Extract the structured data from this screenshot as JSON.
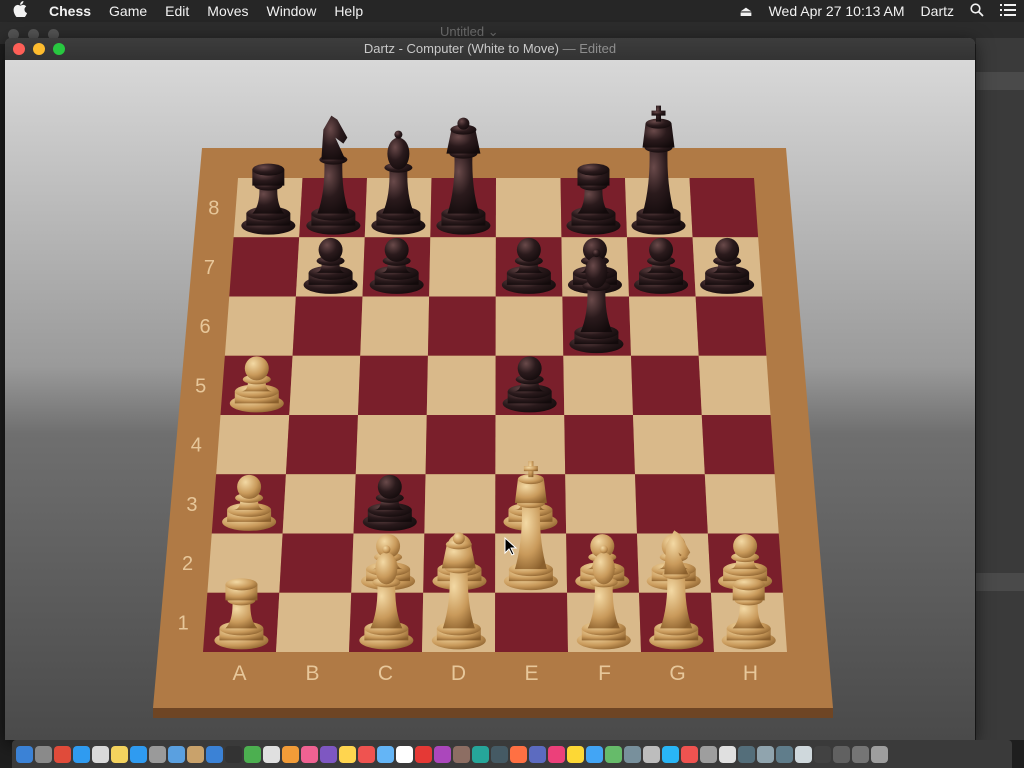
{
  "menubar": {
    "apple": "",
    "items": [
      "Chess",
      "Game",
      "Edit",
      "Moves",
      "Window",
      "Help"
    ],
    "datetime": "Wed Apr 27  10:13 AM",
    "user": "Dartz"
  },
  "background_window": {
    "title": "Untitled ⌄"
  },
  "window": {
    "title": "Dartz - Computer   (White to Move)",
    "edited": " — Edited"
  },
  "board": {
    "files": [
      "A",
      "B",
      "C",
      "D",
      "E",
      "F",
      "G",
      "H"
    ],
    "ranks": [
      "8",
      "7",
      "6",
      "5",
      "4",
      "3",
      "2",
      "1"
    ],
    "light_square": "#d9b98a",
    "dark_square": "#7a1f2b",
    "frame": "#b07a45",
    "pieces": [
      {
        "color": "black",
        "type": "rook",
        "square": "a8"
      },
      {
        "color": "black",
        "type": "knight",
        "square": "b8"
      },
      {
        "color": "black",
        "type": "bishop",
        "square": "c8"
      },
      {
        "color": "black",
        "type": "queen",
        "square": "d8"
      },
      {
        "color": "black",
        "type": "rook",
        "square": "f8"
      },
      {
        "color": "black",
        "type": "king",
        "square": "g8"
      },
      {
        "color": "black",
        "type": "pawn",
        "square": "b7"
      },
      {
        "color": "black",
        "type": "pawn",
        "square": "c7"
      },
      {
        "color": "black",
        "type": "pawn",
        "square": "e7"
      },
      {
        "color": "black",
        "type": "pawn",
        "square": "f7"
      },
      {
        "color": "black",
        "type": "pawn",
        "square": "g7"
      },
      {
        "color": "black",
        "type": "pawn",
        "square": "h7"
      },
      {
        "color": "black",
        "type": "bishop",
        "square": "f6"
      },
      {
        "color": "black",
        "type": "pawn",
        "square": "e5"
      },
      {
        "color": "black",
        "type": "pawn",
        "square": "c3"
      },
      {
        "color": "white",
        "type": "pawn",
        "square": "a5"
      },
      {
        "color": "white",
        "type": "pawn",
        "square": "a3"
      },
      {
        "color": "white",
        "type": "pawn",
        "square": "e3"
      },
      {
        "color": "white",
        "type": "pawn",
        "square": "c2"
      },
      {
        "color": "white",
        "type": "pawn",
        "square": "d2"
      },
      {
        "color": "white",
        "type": "king",
        "square": "e2"
      },
      {
        "color": "white",
        "type": "pawn",
        "square": "f2"
      },
      {
        "color": "white",
        "type": "pawn",
        "square": "g2"
      },
      {
        "color": "white",
        "type": "pawn",
        "square": "h2"
      },
      {
        "color": "white",
        "type": "rook",
        "square": "a1"
      },
      {
        "color": "white",
        "type": "bishop",
        "square": "c1"
      },
      {
        "color": "white",
        "type": "queen",
        "square": "d1"
      },
      {
        "color": "white",
        "type": "bishop",
        "square": "f1"
      },
      {
        "color": "white",
        "type": "knight",
        "square": "g1"
      },
      {
        "color": "white",
        "type": "rook",
        "square": "h1"
      }
    ]
  },
  "dock": {
    "colors": [
      "#3b82d6",
      "#8a8a8a",
      "#e04b3a",
      "#2f9bf0",
      "#d9d9d9",
      "#f4d35e",
      "#2f9bf0",
      "#9a9a9a",
      "#5aa0e0",
      "#c9a26b",
      "#3b82d6",
      "#333333",
      "#4caf50",
      "#e0e0e0",
      "#f29c38",
      "#f06292",
      "#7e57c2",
      "#ffd54f",
      "#ef5350",
      "#64b5f6",
      "#ffffff",
      "#e53935",
      "#ab47bc",
      "#8d6e63",
      "#26a69a",
      "#455a64",
      "#ff7043",
      "#5c6bc0",
      "#ec407a",
      "#fdd835",
      "#42a5f5",
      "#66bb6a",
      "#78909c",
      "#bdbdbd",
      "#29b6f6",
      "#ef5350",
      "#9e9e9e",
      "#e0e0e0",
      "#546e7a",
      "#90a4ae",
      "#607d8b",
      "#cfd8dc",
      "#424242",
      "#616161",
      "#757575",
      "#9e9e9e"
    ]
  }
}
